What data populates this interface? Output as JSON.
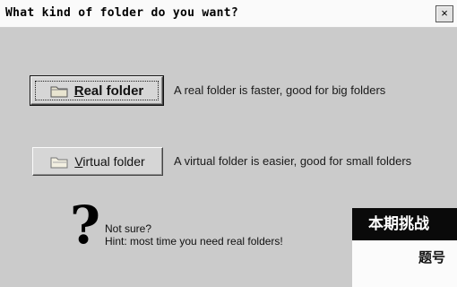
{
  "window": {
    "title": "What kind of folder do you want?",
    "close_label": "×"
  },
  "real_folder": {
    "hotkey": "R",
    "label_rest": "eal folder",
    "description": "A real folder is faster, good for big folders",
    "icon": "folder-icon"
  },
  "virtual_folder": {
    "hotkey": "V",
    "label_rest": "irtual folder",
    "description": "A virtual folder is easier, good for small folders",
    "icon": "folder-icon"
  },
  "hint": {
    "icon": "question-mark-icon",
    "symbol": "?",
    "line1": "Not sure?",
    "line2": "Hint: most time you need real folders!"
  },
  "overlay": {
    "banner_text": "本期挑战",
    "sub_text": "题号"
  },
  "colors": {
    "dialog_bg": "#cbcbcb",
    "titlebar_bg": "#fafafa",
    "overlay_bg": "#0a0a0a"
  }
}
